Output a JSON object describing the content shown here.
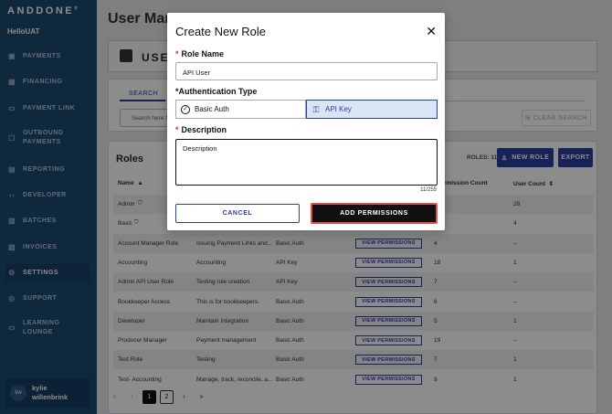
{
  "brand": "ANDDONE",
  "brand_mark": "®",
  "org": "HelloUAT",
  "nav": [
    {
      "label": "PAYMENTS",
      "icon": "payments-icon",
      "glyph": "▣"
    },
    {
      "label": "FINANCING",
      "icon": "financing-icon",
      "glyph": "▦"
    },
    {
      "label": "PAYMENT LINK",
      "icon": "payment-link-icon",
      "glyph": "▭"
    },
    {
      "label": "OUTBOUND",
      "label2": "PAYMENTS",
      "icon": "outbound-payments-icon",
      "glyph": "▢"
    },
    {
      "label": "REPORTING",
      "icon": "reporting-icon",
      "glyph": "▤"
    },
    {
      "label": "DEVELOPER",
      "icon": "developer-icon",
      "glyph": "‹›"
    },
    {
      "label": "BATCHES",
      "icon": "batches-icon",
      "glyph": "▥"
    },
    {
      "label": "INVOICES",
      "icon": "invoices-icon",
      "glyph": "▧"
    },
    {
      "label": "SETTINGS",
      "icon": "settings-icon",
      "glyph": "⚙"
    },
    {
      "label": "SUPPORT",
      "icon": "support-icon",
      "glyph": "◎"
    },
    {
      "label": "LEARNING",
      "label2": "LOUNGE",
      "icon": "learning-lounge-icon",
      "glyph": "▭"
    }
  ],
  "user": {
    "initials": "kw",
    "first": "kylie",
    "last": "willenbrink"
  },
  "page_title": "User Man",
  "panel_header": "USE",
  "search": {
    "tab": "SEARCH",
    "placeholder": "Search here fo",
    "clear": "CLEAR SEARCH"
  },
  "roles": {
    "title": "Roles",
    "count": "ROLES: 11",
    "new_role": "NEW ROLE",
    "export": "EXPORT",
    "headers": {
      "name": "Name",
      "name_sort": "▲",
      "perm_count": "rmission Count",
      "user_count": "User Count",
      "user_sort": "⇕"
    },
    "perm_label": "VIEW PERMISSIONS",
    "rows": [
      {
        "name": "Admin",
        "desc": "",
        "auth": "",
        "perm": "",
        "users": "28"
      },
      {
        "name": "Basic",
        "desc": "",
        "auth": "",
        "perm": "",
        "users": "4"
      },
      {
        "name": "Account Manager Role",
        "desc": "Issuing Payment Links and...",
        "auth": "Basic Auth",
        "perm": "4",
        "users": "--"
      },
      {
        "name": "Accounting",
        "desc": "Accounting",
        "auth": "API Key",
        "perm": "18",
        "users": "1"
      },
      {
        "name": "Admin API User Role",
        "desc": "Testing role creation",
        "auth": "API Key",
        "perm": "7",
        "users": "--"
      },
      {
        "name": "Bookkeeper Access",
        "desc": "This is for bookkeepers.",
        "auth": "Basic Auth",
        "perm": "6",
        "users": "--"
      },
      {
        "name": "Developer",
        "desc": "Maintain Integration",
        "auth": "Basic Auth",
        "perm": "5",
        "users": "1"
      },
      {
        "name": "Producer Manager",
        "desc": "Payment management",
        "auth": "Basic Auth",
        "perm": "19",
        "users": "--"
      },
      {
        "name": "Test Role",
        "desc": "Testing",
        "auth": "Basic Auth",
        "perm": "7",
        "users": "1"
      },
      {
        "name": "Test- Accounting",
        "desc": "Manage, track, reconcile, a...",
        "auth": "Basic Auth",
        "perm": "9",
        "users": "1"
      }
    ]
  },
  "pager": {
    "first": "«",
    "prev": "‹",
    "page1": "1",
    "page2": "2",
    "next": "›",
    "last": "»"
  },
  "modal": {
    "title": "Create New Role",
    "close": "✕",
    "role_name_label": "Role Name",
    "role_name_value": "API User",
    "auth_label": "*Authentication Type",
    "auth_basic": "Basic Auth",
    "auth_api": "API Key",
    "desc_label": "Description",
    "desc_value": "Description",
    "char_count": "11/255",
    "cancel": "CANCEL",
    "add": "ADD PERMISSIONS",
    "required": "*"
  }
}
